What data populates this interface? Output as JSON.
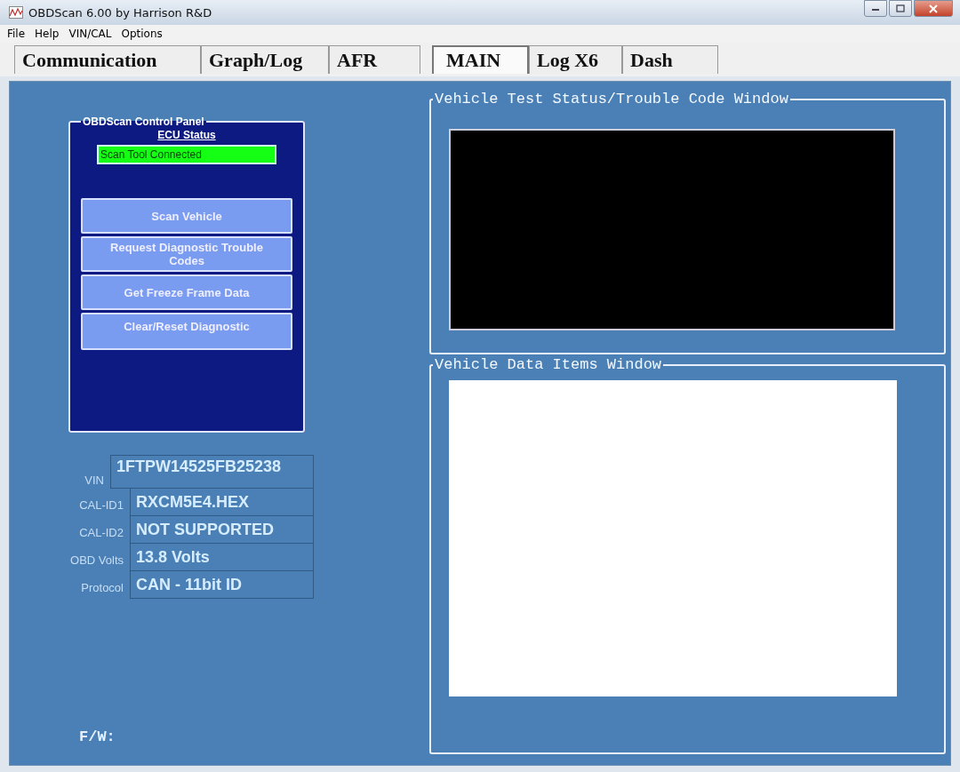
{
  "window": {
    "title": "OBDScan 6.00  by Harrison R&D"
  },
  "menu": [
    "File",
    "Help",
    "VIN/CAL",
    "Options"
  ],
  "tabs": [
    {
      "label": "Communication",
      "selected": false
    },
    {
      "label": "Graph/Log",
      "selected": false
    },
    {
      "label": "AFR",
      "selected": false
    },
    {
      "label": "MAIN",
      "selected": true
    },
    {
      "label": "Log X6",
      "selected": false
    },
    {
      "label": "Dash",
      "selected": false
    }
  ],
  "control_panel": {
    "title": "OBDScan Control Panel",
    "status_label": "ECU Status",
    "status": "Scan Tool Connected",
    "buttons": [
      "Scan Vehicle",
      "Request Diagnostic Trouble Codes",
      "Get Freeze Frame Data",
      "Clear/Reset Diagnostic"
    ]
  },
  "vehicle_info": [
    {
      "label": "VIN",
      "value": "1FTPW14525FB25238"
    },
    {
      "label": "CAL-ID1",
      "value": "RXCM5E4.HEX"
    },
    {
      "label": "CAL-ID2",
      "value": "NOT SUPPORTED"
    },
    {
      "label": "OBD Volts",
      "value": "13.8 Volts"
    },
    {
      "label": "Protocol",
      "value": "CAN - 11bit ID"
    }
  ],
  "firmware_label": "F/W:",
  "status_window": {
    "title": "Vehicle Test Status/Trouble Code Window"
  },
  "data_window": {
    "title": "Vehicle Data Items Window"
  }
}
